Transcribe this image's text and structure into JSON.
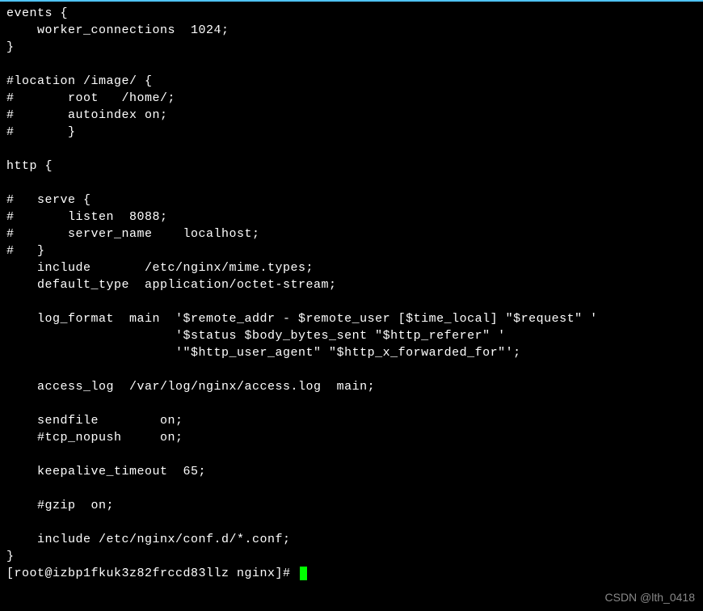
{
  "lines": [
    "events {",
    "    worker_connections  1024;",
    "}",
    "",
    "#location /image/ {",
    "#       root   /home/;",
    "#       autoindex on;",
    "#       }",
    "",
    "http {",
    "",
    "#   serve {",
    "#       listen  8088;",
    "#       server_name    localhost;",
    "#   }",
    "    include       /etc/nginx/mime.types;",
    "    default_type  application/octet-stream;",
    "",
    "    log_format  main  '$remote_addr - $remote_user [$time_local] \"$request\" '",
    "                      '$status $body_bytes_sent \"$http_referer\" '",
    "                      '\"$http_user_agent\" \"$http_x_forwarded_for\"';",
    "",
    "    access_log  /var/log/nginx/access.log  main;",
    "",
    "    sendfile        on;",
    "    #tcp_nopush     on;",
    "",
    "    keepalive_timeout  65;",
    "",
    "    #gzip  on;",
    "",
    "    include /etc/nginx/conf.d/*.conf;",
    "}"
  ],
  "prompt": "[root@izbp1fkuk3z82frccd83llz nginx]# ",
  "watermark": "CSDN @lth_0418"
}
